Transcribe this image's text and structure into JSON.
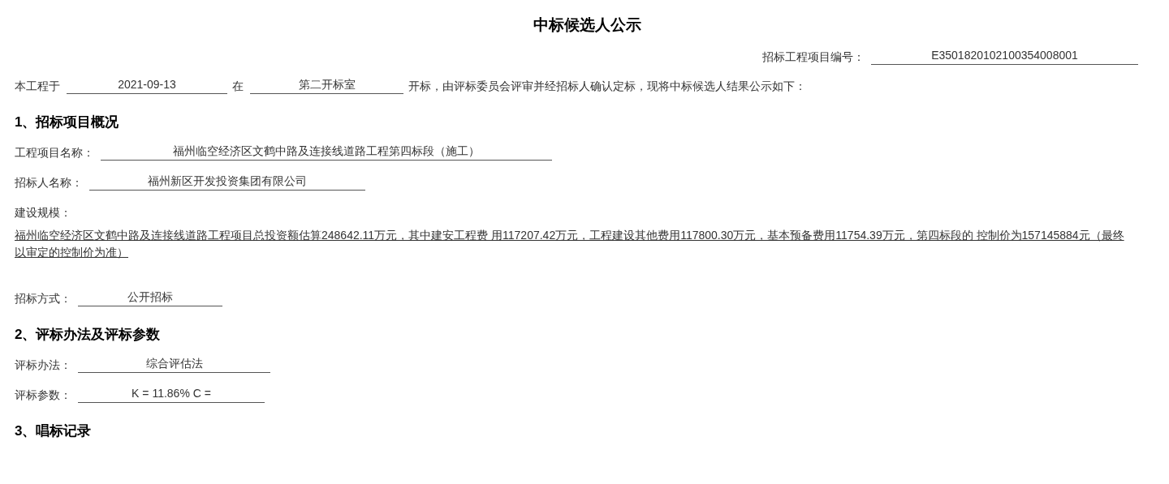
{
  "title": "中标候选人公示",
  "project_no": {
    "label": "招标工程项目编号：",
    "value": "E3501820102100354008001"
  },
  "intro": {
    "prefix": "本工程于",
    "date": "2021-09-13",
    "mid": "在",
    "place": "第二开标室",
    "suffix": "开标，由评标委员会评审并经招标人确认定标，现将中标候选人结果公示如下："
  },
  "sections": [
    {
      "heading": "1、招标项目概况",
      "fields": [
        {
          "kind": "line",
          "label": "工程项目名称：",
          "value": "福州临空经济区文鹤中路及连接线道路工程第四标段（施工）"
        },
        {
          "kind": "line",
          "label": "招标人名称：",
          "value": "福州新区开发投资集团有限公司"
        },
        {
          "kind": "paragraph",
          "label": "建设规模：",
          "value": "福州临空经济区文鹤中路及连接线道路工程项目总投资额估算248642.11万元，其中建安工程费 用117207.42万元，工程建设其他费用117800.30万元，基本预备费用11754.39万元，第四标段的 控制价为157145884元（最终以审定的控制价为准）"
        },
        {
          "kind": "line",
          "label": "招标方式：",
          "value": "公开招标"
        }
      ]
    },
    {
      "heading": "2、评标办法及评标参数",
      "fields": [
        {
          "kind": "line",
          "label": "评标办法：",
          "value": "综合评估法"
        },
        {
          "kind": "line",
          "label": "评标参数：",
          "value": "K = 11.86%  C ="
        }
      ]
    },
    {
      "heading": "3、唱标记录"
    }
  ]
}
